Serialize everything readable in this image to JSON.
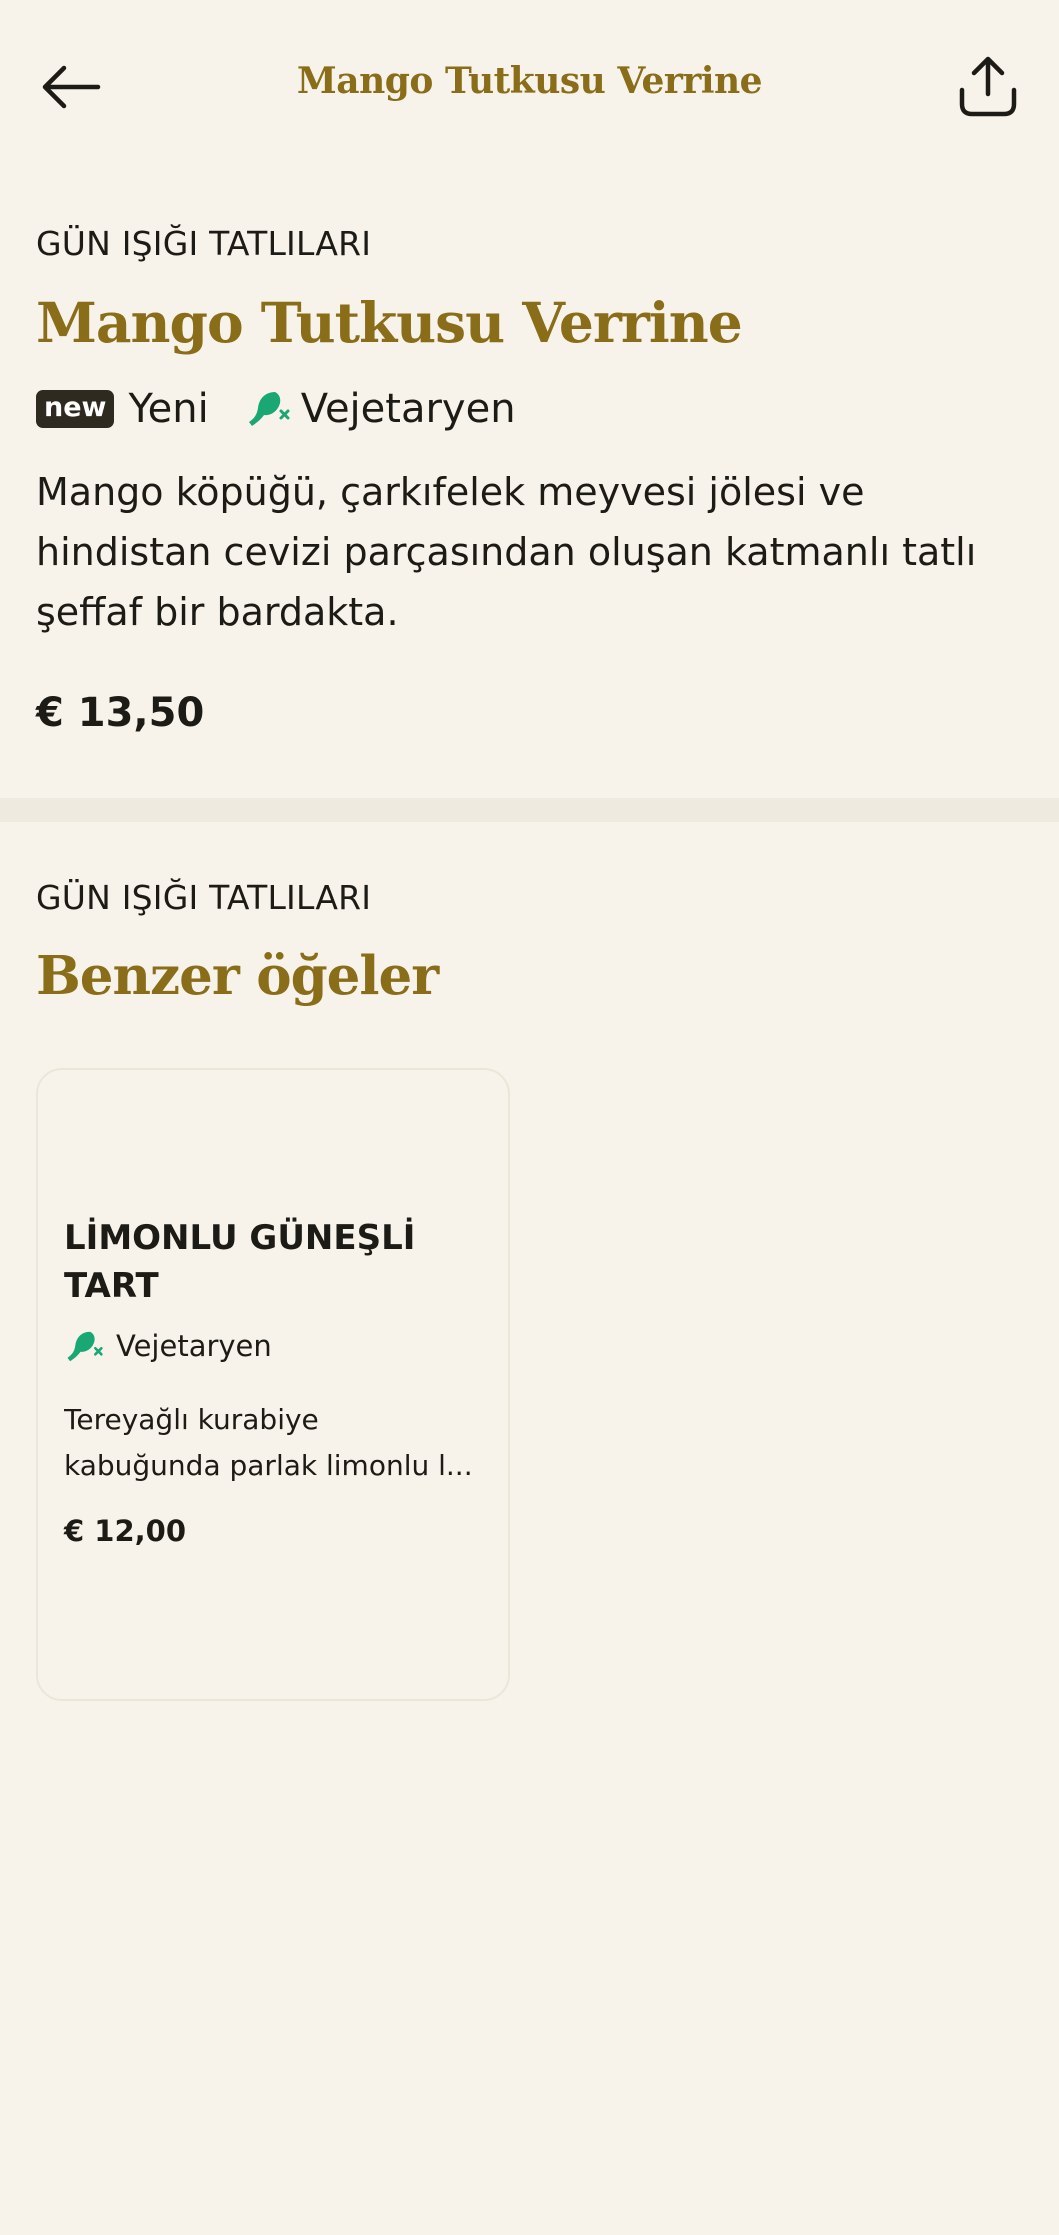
{
  "header": {
    "title": "Mango Tutkusu Verrine",
    "back_icon": "arrow-left-icon",
    "share_icon": "share-icon"
  },
  "product": {
    "category": "GÜN IŞIĞI TATLILARI",
    "name": "Mango Tutkusu Verrine",
    "badge": "new",
    "badge_label": "Yeni",
    "diet_label": "Vejetaryen",
    "diet_icon": "vegetarian-leaf-icon",
    "description": "Mango köpüğü, çarkıfelek meyvesi jölesi ve hindistan cevizi parçasından oluşan katmanlı tatlı şeffaf bir bardakta.",
    "price": "€ 13,50"
  },
  "similar": {
    "category": "GÜN IŞIĞI TATLILARI",
    "title": "Benzer öğeler",
    "items": [
      {
        "name": "LİMONLU GÜNEŞLİ TART",
        "diet_label": "Vejetaryen",
        "description_line1": "Tereyağlı kurabiye",
        "description_line2": "kabuğunda parlak limonlu l...",
        "price": "€ 12,00"
      }
    ]
  },
  "colors": {
    "background": "#f7f3eb",
    "accent": "#8a6d18",
    "text": "#1d1b16",
    "vegetarian": "#19a874",
    "badge": "#2e2a1f"
  }
}
